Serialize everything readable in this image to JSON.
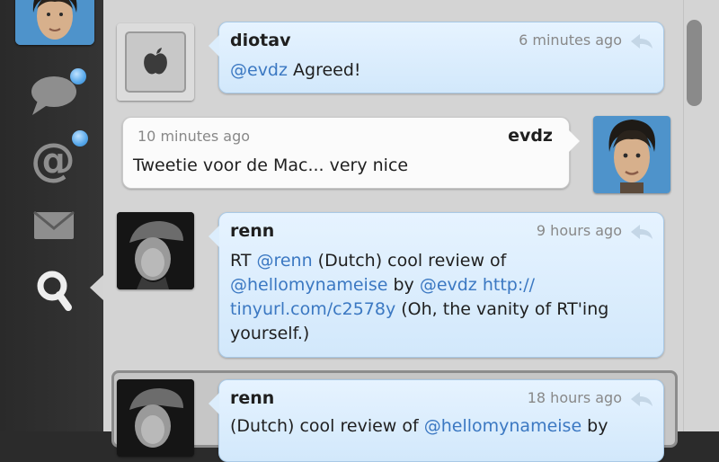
{
  "sidebar": {
    "icons": [
      "user-avatar",
      "speech-bubble-icon",
      "at-sign-icon",
      "envelope-icon",
      "magnifier-icon"
    ]
  },
  "tweets": [
    {
      "user": "diotav",
      "time": "6 minutes ago",
      "text": [
        {
          "t": "@evdz",
          "link": true
        },
        {
          "t": " Agreed!",
          "link": false
        }
      ]
    },
    {
      "user": "evdz",
      "time": "10 minutes ago",
      "text": [
        {
          "t": "Tweetie voor de Mac... very nice",
          "link": false
        }
      ]
    },
    {
      "user": "renn",
      "time": "9 hours ago",
      "lines": [
        [
          {
            "t": "RT ",
            "link": false
          },
          {
            "t": "@renn",
            "link": true
          },
          {
            "t": " (Dutch) cool review of",
            "link": false
          }
        ],
        [
          {
            "t": "@hellomynameise",
            "link": true
          },
          {
            "t": " by ",
            "link": false
          },
          {
            "t": "@evdz",
            "link": true
          },
          {
            "t": " ",
            "link": false
          },
          {
            "t": "http://",
            "link": true
          }
        ],
        [
          {
            "t": "tinyurl.com/c2578y",
            "link": true
          },
          {
            "t": " (Oh, the vanity of RT'ing",
            "link": false
          }
        ],
        [
          {
            "t": "yourself.)",
            "link": false
          }
        ]
      ]
    },
    {
      "user": "renn",
      "time": "18 hours ago",
      "lines": [
        [
          {
            "t": "(Dutch) cool review of ",
            "link": false
          },
          {
            "t": "@hellomynameise",
            "link": true
          },
          {
            "t": " by",
            "link": false
          }
        ]
      ]
    }
  ]
}
